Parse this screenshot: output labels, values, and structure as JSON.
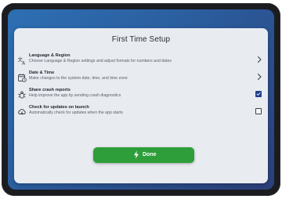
{
  "dialog": {
    "title": "First Time Setup"
  },
  "settings": [
    {
      "title": "Language & Region",
      "description": "Choose Language & Region settings and adjust formats for numbers and dates",
      "icon": "language-icon",
      "control": "chevron"
    },
    {
      "title": "Date & Time",
      "description": "Make changes to the system date, time, and time zone",
      "icon": "calendar-icon",
      "control": "chevron"
    },
    {
      "title": "Share crash reports",
      "description": "Help improve the app by sending crash diagnostics",
      "icon": "bug-icon",
      "control": "checkbox",
      "checked": true
    },
    {
      "title": "Check for updates on launch",
      "description": "Automatically check for updates when the app starts",
      "icon": "cloud-download-icon",
      "control": "checkbox",
      "checked": false
    }
  ],
  "done_button": {
    "label": "Done",
    "icon": "bolt-icon",
    "color": "#2e9e3a"
  },
  "colors": {
    "screen_background": "#2d6fb3",
    "panel_background": "#e8ebf0",
    "checkbox_checked": "#1f3f8a"
  }
}
